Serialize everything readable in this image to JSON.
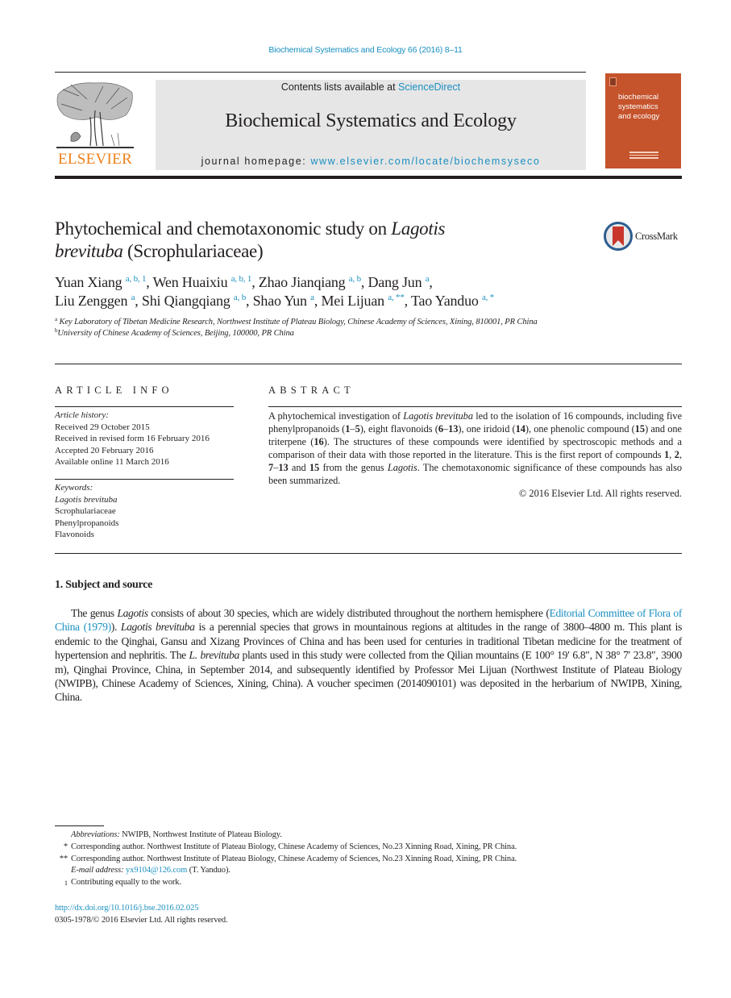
{
  "citation": "Biochemical Systematics and Ecology 66 (2016) 8–11",
  "header": {
    "publisher_name": "ELSEVIER",
    "contents_prefix": "Contents lists available at ",
    "contents_link": "ScienceDirect",
    "journal_name": "Biochemical Systematics and Ecology",
    "homepage_prefix": "journal homepage: ",
    "homepage_link": "www.elsevier.com/locate/biochemsyseco",
    "cover_title_lines": [
      "biochemical",
      "systematics",
      "and ecology"
    ],
    "brand_color": "#ef7f1a",
    "cover_color": "#c5532b",
    "link_color": "#1a8fc0"
  },
  "article": {
    "title_part1": "Phytochemical and chemotaxonomic study on ",
    "title_italic_1": "Lagotis",
    "title_italic_2": "brevituba",
    "title_part2": " (Scrophulariaceae)",
    "crossmark_label": "CrossMark",
    "authors": [
      {
        "name": "Yuan Xiang",
        "sup": "a, b, 1",
        "sep": ", "
      },
      {
        "name": "Wen Huaixiu",
        "sup": "a, b, 1",
        "sep": ", "
      },
      {
        "name": "Zhao Jianqiang",
        "sup": "a, b",
        "sep": ", "
      },
      {
        "name": "Dang Jun",
        "sup": "a",
        "sep": ","
      },
      {
        "name": "Liu Zenggen",
        "sup": "a",
        "sep": ", "
      },
      {
        "name": "Shi Qiangqiang",
        "sup": "a, b",
        "sep": ", "
      },
      {
        "name": "Shao Yun",
        "sup": "a",
        "sep": ", "
      },
      {
        "name": "Mei Lijuan",
        "sup": "a, **",
        "sep": ", "
      },
      {
        "name": "Tao Yanduo",
        "sup": "a, *",
        "sep": ""
      }
    ],
    "affiliations": [
      {
        "mark": "a",
        "text": "Key Laboratory of Tibetan Medicine Research, Northwest Institute of Plateau Biology, Chinese Academy of Sciences, Xining, 810001, PR China"
      },
      {
        "mark": "b",
        "text": "University of Chinese Academy of Sciences, Beijing, 100000, PR China"
      }
    ]
  },
  "article_info": {
    "heading": "ARTICLE INFO",
    "history_label": "Article history:",
    "history": [
      "Received 29 October 2015",
      "Received in revised form 16 February 2016",
      "Accepted 20 February 2016",
      "Available online 11 March 2016"
    ],
    "keywords_label": "Keywords:",
    "keywords": [
      "Lagotis brevituba",
      "Scrophulariaceae",
      "Phenylpropanoids",
      "Flavonoids"
    ]
  },
  "abstract": {
    "heading": "ABSTRACT",
    "segments": [
      {
        "t": "A phytochemical investigation of ",
        "s": "n"
      },
      {
        "t": "Lagotis brevituba",
        "s": "i"
      },
      {
        "t": " led to the isolation of 16 compounds, including five phenylpropanoids (",
        "s": "n"
      },
      {
        "t": "1",
        "s": "b"
      },
      {
        "t": "–",
        "s": "n"
      },
      {
        "t": "5",
        "s": "b"
      },
      {
        "t": "), eight flavonoids (",
        "s": "n"
      },
      {
        "t": "6",
        "s": "b"
      },
      {
        "t": "–",
        "s": "n"
      },
      {
        "t": "13",
        "s": "b"
      },
      {
        "t": "), one iridoid (",
        "s": "n"
      },
      {
        "t": "14",
        "s": "b"
      },
      {
        "t": "), one phenolic compound (",
        "s": "n"
      },
      {
        "t": "15",
        "s": "b"
      },
      {
        "t": ") and one triterpene (",
        "s": "n"
      },
      {
        "t": "16",
        "s": "b"
      },
      {
        "t": "). The structures of these compounds were identified by spectroscopic methods and a comparison of their data with those reported in the literature. This is the first report of compounds ",
        "s": "n"
      },
      {
        "t": "1",
        "s": "b"
      },
      {
        "t": ", ",
        "s": "n"
      },
      {
        "t": "2",
        "s": "b"
      },
      {
        "t": ", ",
        "s": "n"
      },
      {
        "t": "7",
        "s": "b"
      },
      {
        "t": "–",
        "s": "n"
      },
      {
        "t": "13",
        "s": "b"
      },
      {
        "t": " and ",
        "s": "n"
      },
      {
        "t": "15",
        "s": "b"
      },
      {
        "t": " from the genus ",
        "s": "n"
      },
      {
        "t": "Lagotis",
        "s": "i"
      },
      {
        "t": ". The chemotaxonomic significance of these compounds has also been summarized.",
        "s": "n"
      }
    ],
    "copyright": "© 2016 Elsevier Ltd. All rights reserved."
  },
  "section1": {
    "heading": "1.  Subject and source",
    "segments": [
      {
        "t": "The genus ",
        "s": "n"
      },
      {
        "t": "Lagotis",
        "s": "i"
      },
      {
        "t": " consists of about 30 species, which are widely distributed throughout the northern hemisphere (",
        "s": "n"
      },
      {
        "t": "Editorial Committee of Flora of China (1979)",
        "s": "l"
      },
      {
        "t": "). ",
        "s": "n"
      },
      {
        "t": "Lagotis brevituba",
        "s": "i"
      },
      {
        "t": " is a perennial species that grows in mountainous regions at altitudes in the range of 3800–4800 m. This plant is endemic to the Qinghai, Gansu and Xizang Provinces of China and has been used for centuries in traditional Tibetan medicine for the treatment of hypertension and nephritis. The ",
        "s": "n"
      },
      {
        "t": "L. brevituba",
        "s": "i"
      },
      {
        "t": " plants used in this study were collected from the Qilian mountains (E 100° 19′ 6.8″, N 38° 7′ 23.8″, 3900 m), Qinghai Province, China, in September 2014, and subsequently identified by Professor Mei Lijuan (Northwest Institute of Plateau Biology (NWIPB), Chinese Academy of Sciences, Xining, China). A voucher specimen (2014090101) was deposited in the herbarium of NWIPB, Xining, China.",
        "s": "n"
      }
    ]
  },
  "footnotes": {
    "abbrev_label": "Abbreviations:",
    "abbrev_text": " NWIPB, Northwest Institute of Plateau Biology.",
    "corr1_mark": "*",
    "corr1_text": "Corresponding author. Northwest Institute of Plateau Biology, Chinese Academy of Sciences, No.23 Xinning Road, Xining, PR China.",
    "corr2_mark": "**",
    "corr2_text": "Corresponding author. Northwest Institute of Plateau Biology, Chinese Academy of Sciences, No.23 Xinning Road, Xining, PR China.",
    "email_label": "E-mail address:",
    "email": "yx9104@126.com",
    "email_suffix": " (T. Yanduo).",
    "contrib_mark": "1",
    "contrib_text": "Contributing equally to the work.",
    "doi": "http://dx.doi.org/10.1016/j.bse.2016.02.025",
    "issn_copyright": "0305-1978/© 2016 Elsevier Ltd. All rights reserved."
  }
}
